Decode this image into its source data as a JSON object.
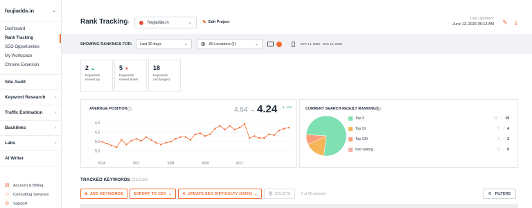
{
  "sidebar": {
    "site": "foujiadda.in",
    "sub_items": [
      {
        "label": "Dashboard",
        "active": false
      },
      {
        "label": "Rank Tracking",
        "active": true
      },
      {
        "label": "SEO Opportunities",
        "active": false
      },
      {
        "label": "My Workspace",
        "active": false
      },
      {
        "label": "Chrome Extension",
        "active": false
      }
    ],
    "sections": [
      {
        "label": "Site Audit",
        "arrow": ""
      },
      {
        "label": "Keyword Research",
        "arrow": "›"
      },
      {
        "label": "Traffic Estimation",
        "arrow": "›"
      },
      {
        "label": "Backlinks",
        "arrow": "›"
      },
      {
        "label": "Labs",
        "arrow": "›"
      },
      {
        "label": "AI Writer",
        "arrow": ""
      }
    ],
    "bottom_items": [
      {
        "label": "Account & Billing",
        "icon": "account-icon"
      },
      {
        "label": "Consulting Services",
        "icon": "consulting-icon"
      },
      {
        "label": "Support",
        "icon": "support-icon"
      }
    ]
  },
  "header": {
    "title": "Rank Tracking",
    "site_select": "foujiadda.in",
    "edit_project": "Edit Project",
    "last_updated_label": "Last Updated:",
    "last_updated_value": "June 13, 2025 06:13 AM"
  },
  "filters": {
    "label": "SHOWING RANKINGS FOR:",
    "period": "Last 30 days",
    "location": "All Locations (1)",
    "date_range": "MAY 14, 2025 - JUN 13, 2025"
  },
  "stats": [
    {
      "value": "2",
      "label": "Keywords moved up",
      "trend": "up"
    },
    {
      "value": "5",
      "label": "Keywords moved down",
      "trend": "down"
    },
    {
      "value": "18",
      "label": "Keywords unchanged",
      "trend": "none"
    }
  ],
  "avg_position": {
    "title": "AVERAGE POSITION",
    "old": "4.84",
    "arrow": "→",
    "new": "4.24",
    "change": "▲ +0.6"
  },
  "serp": {
    "title": "CURRENT SEARCH RESULT RANKINGS",
    "rows": [
      {
        "label": "Top 3",
        "old": "20",
        "new": "19",
        "color": "#7fe0b3"
      },
      {
        "label": "Top 10",
        "old": "5",
        "new": "4",
        "color": "#f5b65a"
      },
      {
        "label": "Top 100",
        "old": "0",
        "new": "2",
        "color": "#f9a07a"
      },
      {
        "label": "Not ranking",
        "old": "0",
        "new": "0",
        "color": "#f2b0a6"
      }
    ]
  },
  "chart_data": {
    "type": "line",
    "title": "AVERAGE POSITION",
    "x_ticks": [
      "5/14",
      "5/21",
      "5/28",
      "6/04",
      "6/11"
    ],
    "y_ticks": [
      "4.0",
      "4.5",
      "5.0",
      "5.5"
    ],
    "ylim": [
      3.8,
      5.8
    ],
    "y_inverted": true,
    "series": [
      {
        "values": [
          5.0,
          5.1,
          5.2,
          5.3,
          4.9,
          5.15,
          4.95,
          4.85,
          4.95,
          4.75,
          4.9,
          5.05,
          5.15,
          5.05,
          5.0,
          4.85,
          4.75,
          4.75,
          4.9,
          4.6,
          4.55,
          4.7,
          4.6,
          4.3,
          4.15,
          4.35,
          4.15,
          4.35,
          4.25,
          4.05,
          4.8,
          4.7,
          4.8,
          4.8,
          4.6,
          4.65,
          4.4,
          4.3,
          4.25
        ],
        "color": "#f26b32"
      }
    ],
    "pie": [
      {
        "label": "Top 3",
        "value": 19,
        "color": "#7fe0b3"
      },
      {
        "label": "Top 10",
        "value": 4,
        "color": "#f5b65a"
      },
      {
        "label": "Top 100",
        "value": 2,
        "color": "#f9a07a"
      },
      {
        "label": "Not ranking",
        "value": 0,
        "color": "#f2b0a6"
      }
    ]
  },
  "tracked": {
    "title": "TRACKED KEYWORDS",
    "count": "(25/125)",
    "add": "ADD KEYWORDS",
    "export": "EXPORT TO CSV",
    "update": "UPDATE SEO DIFFICULTY (0/200)",
    "delete": "DELETE",
    "selected": "0 of 25 selected",
    "filters": "FILTERS"
  },
  "colors": {
    "accent": "#f26b32",
    "up": "#2bb673",
    "down": "#e94b3c"
  }
}
